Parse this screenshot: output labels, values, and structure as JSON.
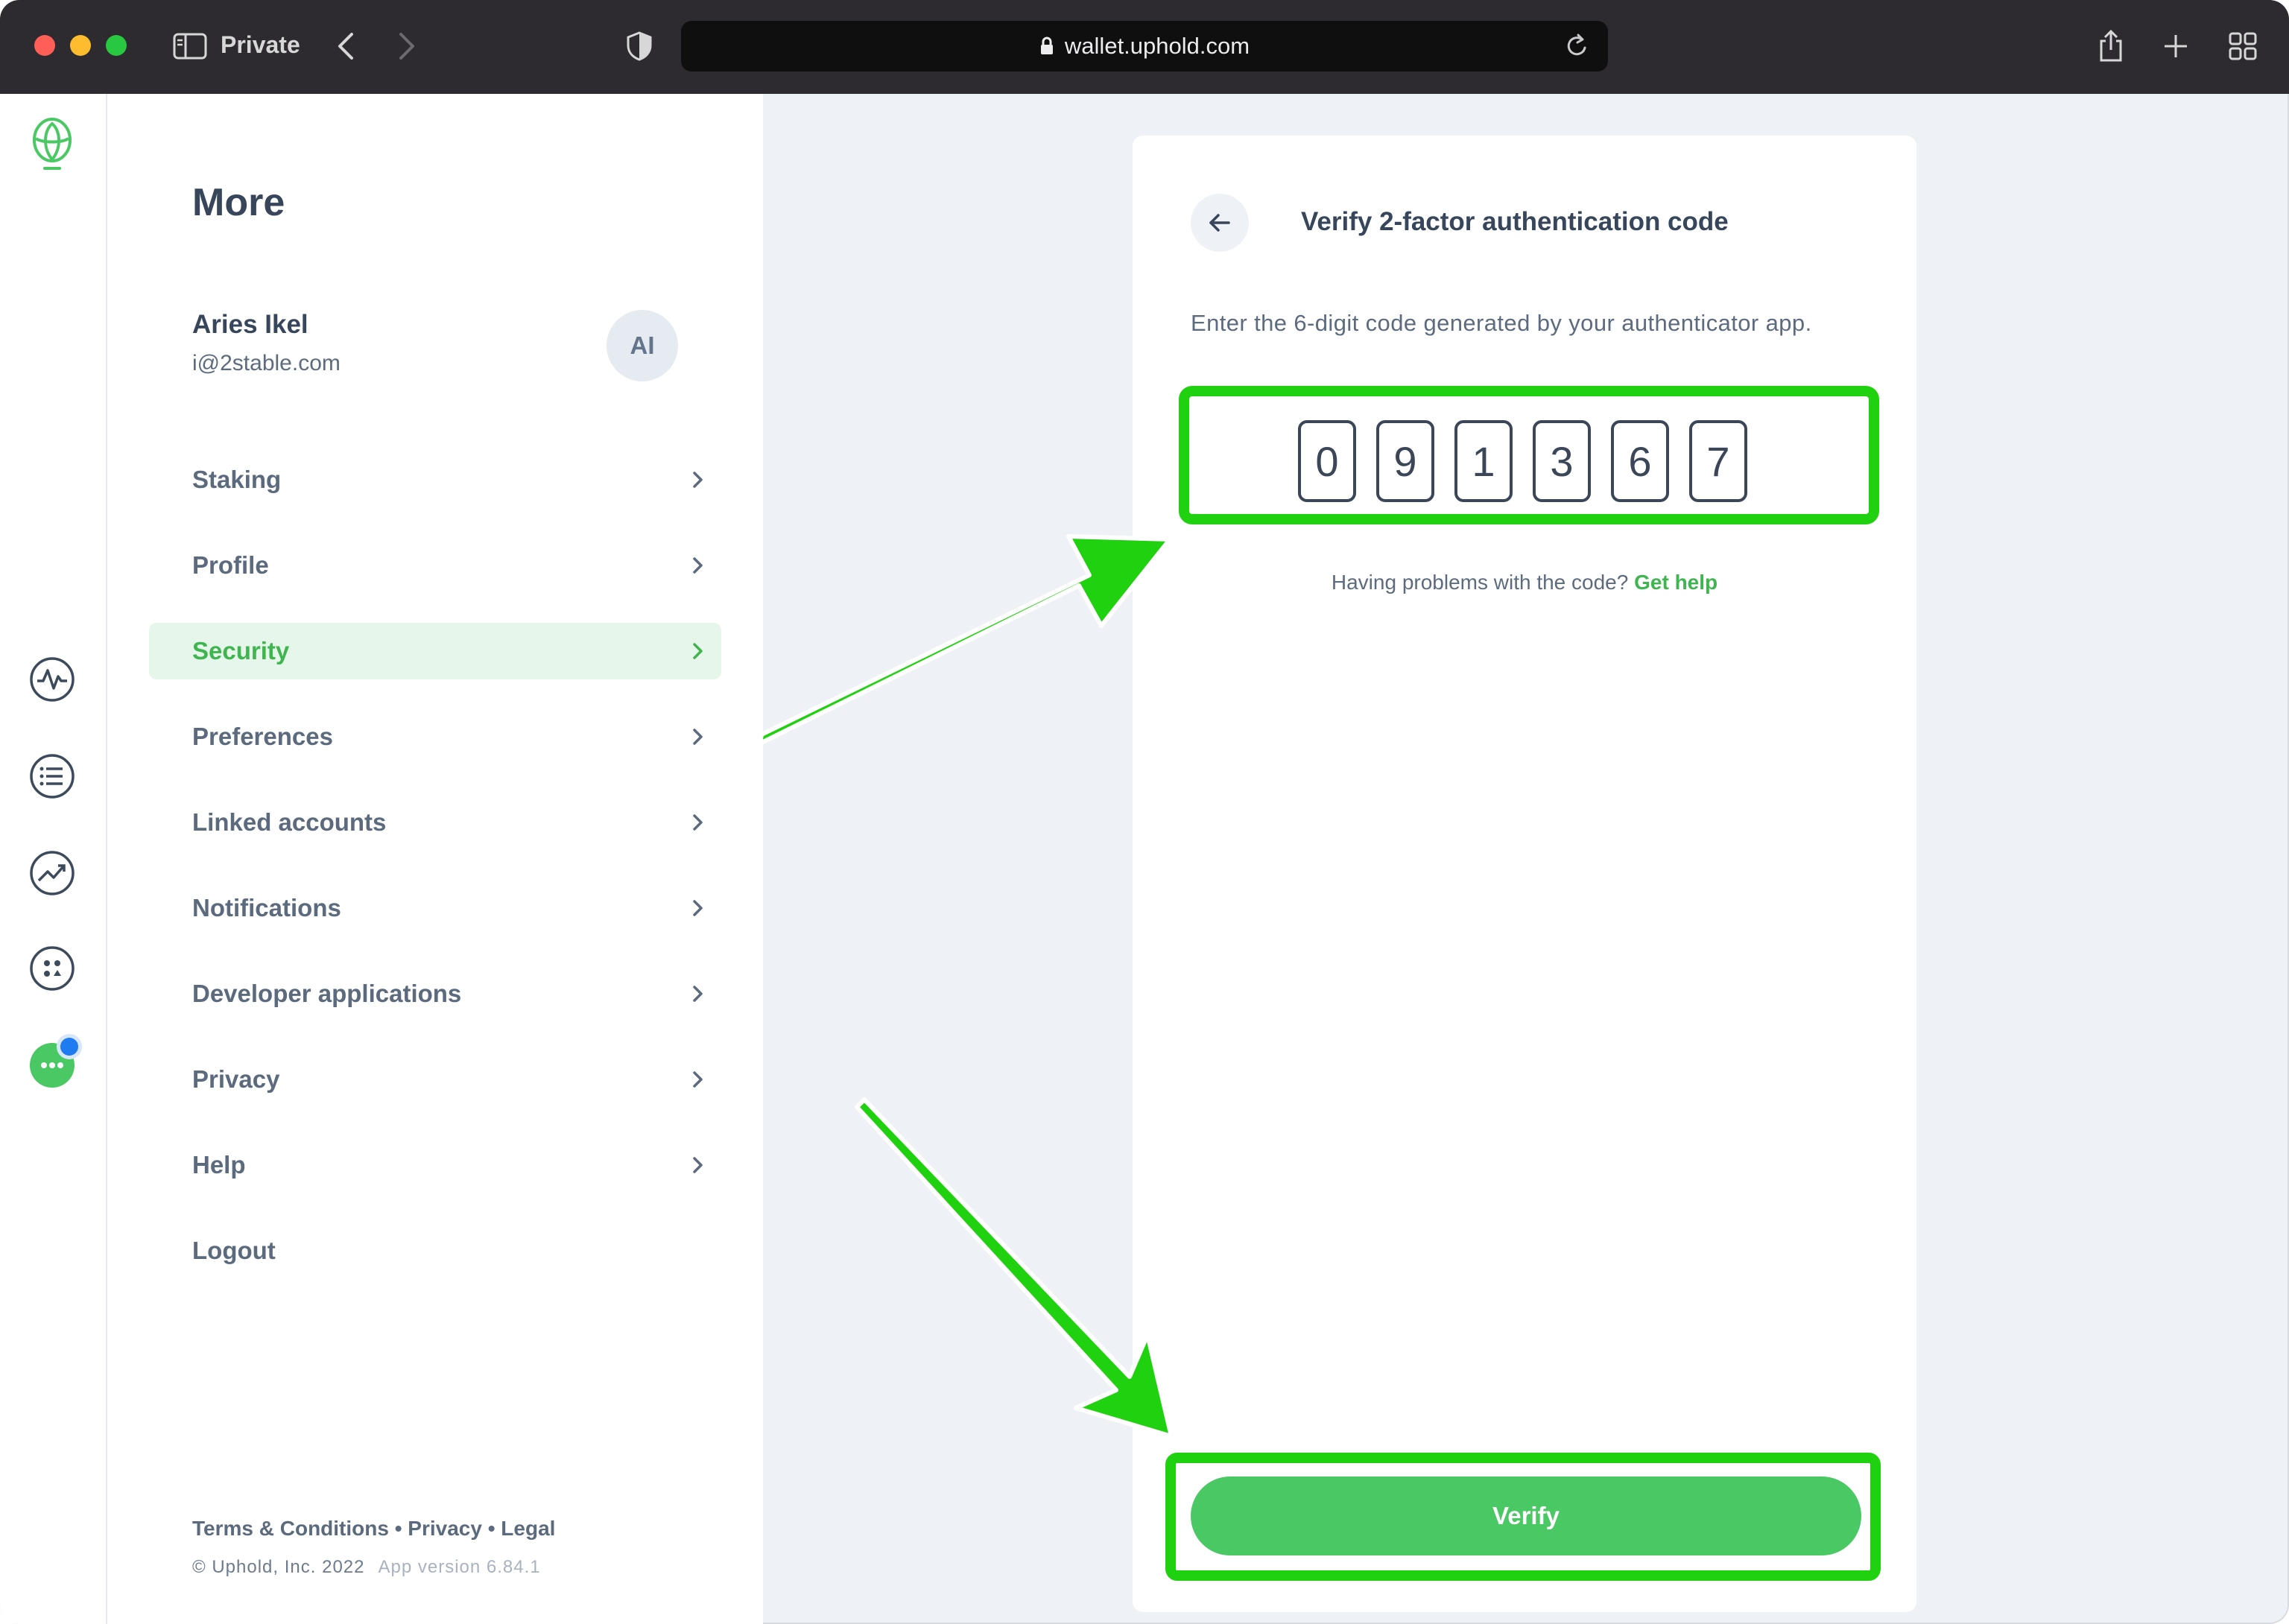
{
  "browser": {
    "private_label": "Private",
    "url": "wallet.uphold.com"
  },
  "more": {
    "title": "More",
    "user": {
      "name": "Aries Ikel",
      "email": "i@2stable.com",
      "initials": "AI"
    },
    "items": [
      {
        "label": "Staking",
        "chevron": true,
        "active": false
      },
      {
        "label": "Profile",
        "chevron": true,
        "active": false
      },
      {
        "label": "Security",
        "chevron": true,
        "active": true
      },
      {
        "label": "Preferences",
        "chevron": true,
        "active": false
      },
      {
        "label": "Linked accounts",
        "chevron": true,
        "active": false
      },
      {
        "label": "Notifications",
        "chevron": true,
        "active": false
      },
      {
        "label": "Developer applications",
        "chevron": true,
        "active": false
      },
      {
        "label": "Privacy",
        "chevron": true,
        "active": false
      },
      {
        "label": "Help",
        "chevron": true,
        "active": false
      },
      {
        "label": "Logout",
        "chevron": false,
        "active": false
      }
    ],
    "footer": {
      "links": "Terms & Conditions • Privacy • Legal",
      "copyright": "© Uphold, Inc. 2022",
      "version": "App version 6.84.1"
    }
  },
  "verify": {
    "title": "Verify 2-factor authentication code",
    "description": "Enter the 6-digit code generated by your authenticator app.",
    "code": [
      "0",
      "9",
      "1",
      "3",
      "6",
      "7"
    ],
    "help_text": "Having problems with the code?",
    "help_link": "Get help",
    "button_label": "Verify"
  },
  "colors": {
    "accent_green": "#49c864",
    "annotation_green": "#1fd10e",
    "text_dark": "#37465a",
    "text_muted": "#5c6a7e"
  }
}
